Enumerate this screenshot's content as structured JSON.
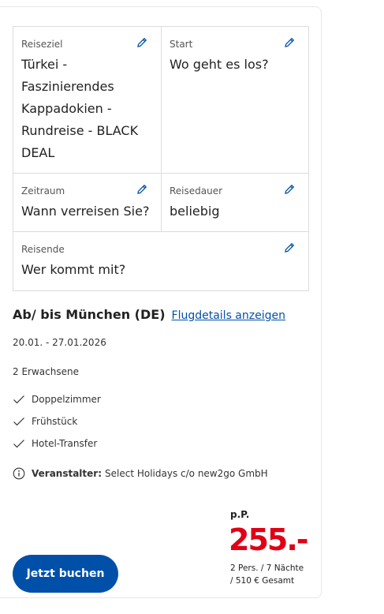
{
  "fields": [
    {
      "label": "Reiseziel",
      "value": "Türkei - Faszinierendes Kappadokien - Rundreise - BLACK DEAL"
    },
    {
      "label": "Start",
      "value": "Wo geht es los?"
    },
    {
      "label": "Zeitraum",
      "value": "Wann verreisen Sie?"
    },
    {
      "label": "Reisedauer",
      "value": "beliebig"
    },
    {
      "label": "Reisende",
      "value": "Wer kommt mit?"
    }
  ],
  "flight": {
    "departure": "Ab/ bis München (DE)",
    "details_link": "Flugdetails anzeigen"
  },
  "dates": "20.01. - 27.01.2026",
  "travelers": "2 Erwachsene",
  "features": [
    "Doppelzimmer",
    "Frühstück",
    "Hotel-Transfer"
  ],
  "organizer": {
    "label": "Veranstalter:",
    "name": "Select Holidays c/o new2go GmbH"
  },
  "price": {
    "per_person_label": "p.P.",
    "amount": "255.-",
    "details_line1": "2 Pers. / 7 Nächte",
    "details_line2": "/ 510 € Gesamt"
  },
  "cta": {
    "label": "Jetzt buchen"
  },
  "colors": {
    "accent": "#0050aa",
    "price": "#e10015"
  },
  "icons": {
    "edit": "pencil-icon",
    "check": "check-icon",
    "info": "info-icon"
  }
}
